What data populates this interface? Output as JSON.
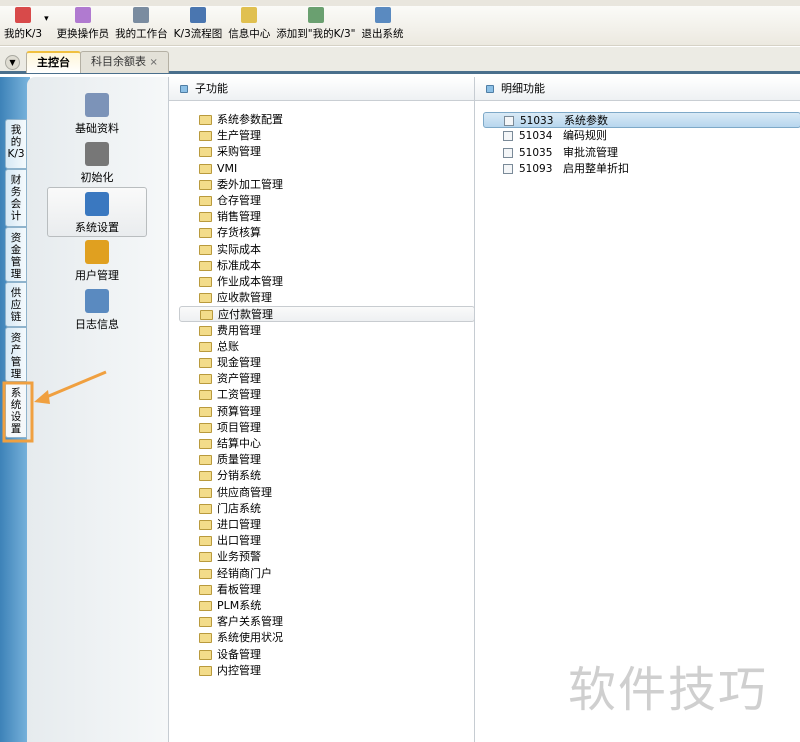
{
  "toolbar": {
    "items": [
      {
        "label": "我的K/3",
        "icon": "star-icon",
        "color": "#d84a4a"
      },
      {
        "label": "更换操作员",
        "icon": "users-icon",
        "color": "#b07ad0"
      },
      {
        "label": "我的工作台",
        "icon": "pen-icon",
        "color": "#7a8ca0"
      },
      {
        "label": "K/3流程图",
        "icon": "flowchart-icon",
        "color": "#4a76b0"
      },
      {
        "label": "信息中心",
        "icon": "message-icon",
        "color": "#e0c050"
      },
      {
        "label": "添加到\"我的K/3\"",
        "icon": "add-favorite-icon",
        "color": "#6aa070"
      },
      {
        "label": "退出系统",
        "icon": "exit-icon",
        "color": "#5a8ac0"
      }
    ]
  },
  "tabs": [
    {
      "label": "主控台",
      "active": true
    },
    {
      "label": "科目余额表",
      "close": "×"
    }
  ],
  "vtabs": [
    {
      "label": "我的K/3"
    },
    {
      "label": "财务会计"
    },
    {
      "label": "资金管理"
    },
    {
      "label": "供应链"
    },
    {
      "label": "资产管理"
    },
    {
      "label": "系统设置",
      "highlighted": true
    }
  ],
  "nav": [
    {
      "label": "基础资料",
      "icon": "basic-data-icon",
      "color": "#7c93b8"
    },
    {
      "label": "初始化",
      "icon": "gear-icon",
      "color": "#777"
    },
    {
      "label": "系统设置",
      "icon": "computer-settings-icon",
      "color": "#3a78c0",
      "selected": true
    },
    {
      "label": "用户管理",
      "icon": "users-icon",
      "color": "#e0a020"
    },
    {
      "label": "日志信息",
      "icon": "clock-icon",
      "color": "#5a8ac0"
    }
  ],
  "sub": {
    "title": "子功能",
    "items": [
      "系统参数配置",
      "生产管理",
      "采购管理",
      "VMI",
      "委外加工管理",
      "仓存管理",
      "销售管理",
      "存货核算",
      "实际成本",
      "标准成本",
      "作业成本管理",
      "应收款管理",
      "应付款管理",
      "费用管理",
      "总账",
      "现金管理",
      "资产管理",
      "工资管理",
      "预算管理",
      "项目管理",
      "结算中心",
      "质量管理",
      "分销系统",
      "供应商管理",
      "门店系统",
      "进口管理",
      "出口管理",
      "业务预警",
      "经销商门户",
      "看板管理",
      "PLM系统",
      "客户关系管理",
      "系统使用状况",
      "设备管理",
      "内控管理"
    ],
    "selected_index": 12
  },
  "detail": {
    "title": "明细功能",
    "items": [
      {
        "code": "51033",
        "label": "系统参数",
        "selected": true
      },
      {
        "code": "51034",
        "label": "编码规则"
      },
      {
        "code": "51035",
        "label": "审批流管理"
      },
      {
        "code": "51093",
        "label": "启用整单折扣"
      }
    ]
  },
  "watermark": "软件技巧",
  "annotation_color": "#f0a040"
}
